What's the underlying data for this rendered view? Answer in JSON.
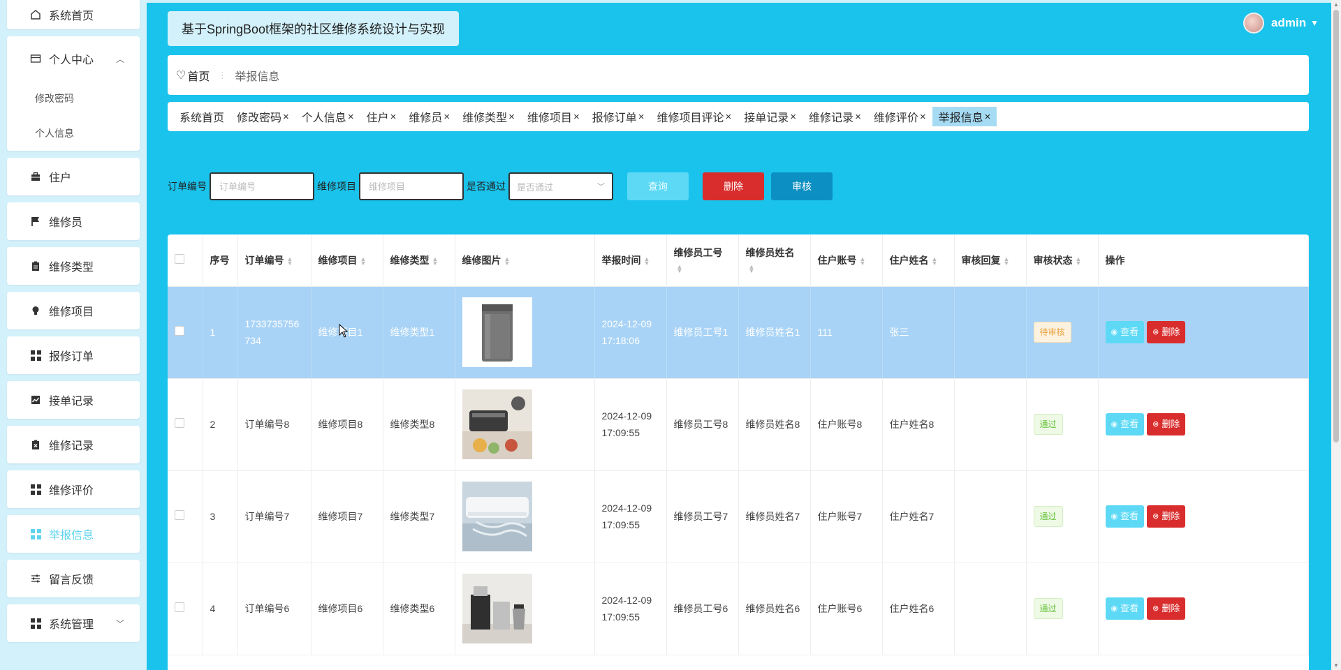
{
  "app_title": "基于SpringBoot框架的社区维修系统设计与实现",
  "user": {
    "name": "admin"
  },
  "sidebar": {
    "home": "系统首页",
    "personal": {
      "label": "个人中心",
      "children": [
        "修改密码",
        "个人信息"
      ]
    },
    "items": [
      {
        "label": "住户",
        "icon": "briefcase-icon"
      },
      {
        "label": "维修员",
        "icon": "flag-icon"
      },
      {
        "label": "维修类型",
        "icon": "clipboard-icon"
      },
      {
        "label": "维修项目",
        "icon": "bulb-icon"
      },
      {
        "label": "报修订单",
        "icon": "grid-icon"
      },
      {
        "label": "接单记录",
        "icon": "chart-icon"
      },
      {
        "label": "维修记录",
        "icon": "clipboard-x-icon"
      },
      {
        "label": "维修评价",
        "icon": "grid-icon"
      },
      {
        "label": "举报信息",
        "icon": "grid-icon",
        "active": true
      },
      {
        "label": "留言反馈",
        "icon": "sliders-icon"
      },
      {
        "label": "系统管理",
        "icon": "grid-icon"
      }
    ]
  },
  "breadcrumb": {
    "home": "首页",
    "current": "举报信息"
  },
  "tags": [
    "系统首页",
    "修改密码",
    "个人信息",
    "住户",
    "维修员",
    "维修类型",
    "维修项目",
    "报修订单",
    "维修项目评论",
    "接单记录",
    "维修记录",
    "维修评价",
    "举报信息"
  ],
  "search": {
    "order_label": "订单编号",
    "order_placeholder": "订单编号",
    "project_label": "维修项目",
    "project_placeholder": "维修项目",
    "pass_label": "是否通过",
    "pass_placeholder": "是否通过",
    "query_btn": "查询",
    "delete_btn": "删除",
    "audit_btn": "审核"
  },
  "table": {
    "headers": [
      "序号",
      "订单编号",
      "维修项目",
      "维修类型",
      "维修图片",
      "举报时间",
      "维修员工号",
      "维修员姓名",
      "住户账号",
      "住户姓名",
      "审核回复",
      "审核状态",
      "操作"
    ],
    "view_label": "查看",
    "delete_label": "删除",
    "rows": [
      {
        "no": "1",
        "order": "1733735756734",
        "project": "维修项目1",
        "type": "维修类型1",
        "image": "washing-machine",
        "time": "2024-12-09 17:18:06",
        "worker_no": "维修员工号1",
        "worker_name": "维修员姓名1",
        "account": "111",
        "resident": "张三",
        "reply": "",
        "status": "待审核"
      },
      {
        "no": "2",
        "order": "订单编号8",
        "project": "维修项目8",
        "type": "维修类型8",
        "image": "kitchen-appliance",
        "time": "2024-12-09 17:09:55",
        "worker_no": "维修员工号8",
        "worker_name": "维修员姓名8",
        "account": "住户账号8",
        "resident": "住户姓名8",
        "reply": "",
        "status": "通过"
      },
      {
        "no": "3",
        "order": "订单编号7",
        "project": "维修项目7",
        "type": "维修类型7",
        "image": "air-conditioner",
        "time": "2024-12-09 17:09:55",
        "worker_no": "维修员工号7",
        "worker_name": "维修员姓名7",
        "account": "住户账号7",
        "resident": "住户姓名7",
        "reply": "",
        "status": "通过"
      },
      {
        "no": "4",
        "order": "订单编号6",
        "project": "维修项目6",
        "type": "维修类型6",
        "image": "coffee-machine",
        "time": "2024-12-09 17:09:55",
        "worker_no": "维修员工号6",
        "worker_name": "维修员姓名6",
        "account": "住户账号6",
        "resident": "住户姓名6",
        "reply": "",
        "status": "通过"
      }
    ]
  },
  "colors": {
    "primary": "#19c3ec",
    "danger": "#d92d2d",
    "audit": "#0c8fc2",
    "selected_row": "#a8d3f6"
  }
}
